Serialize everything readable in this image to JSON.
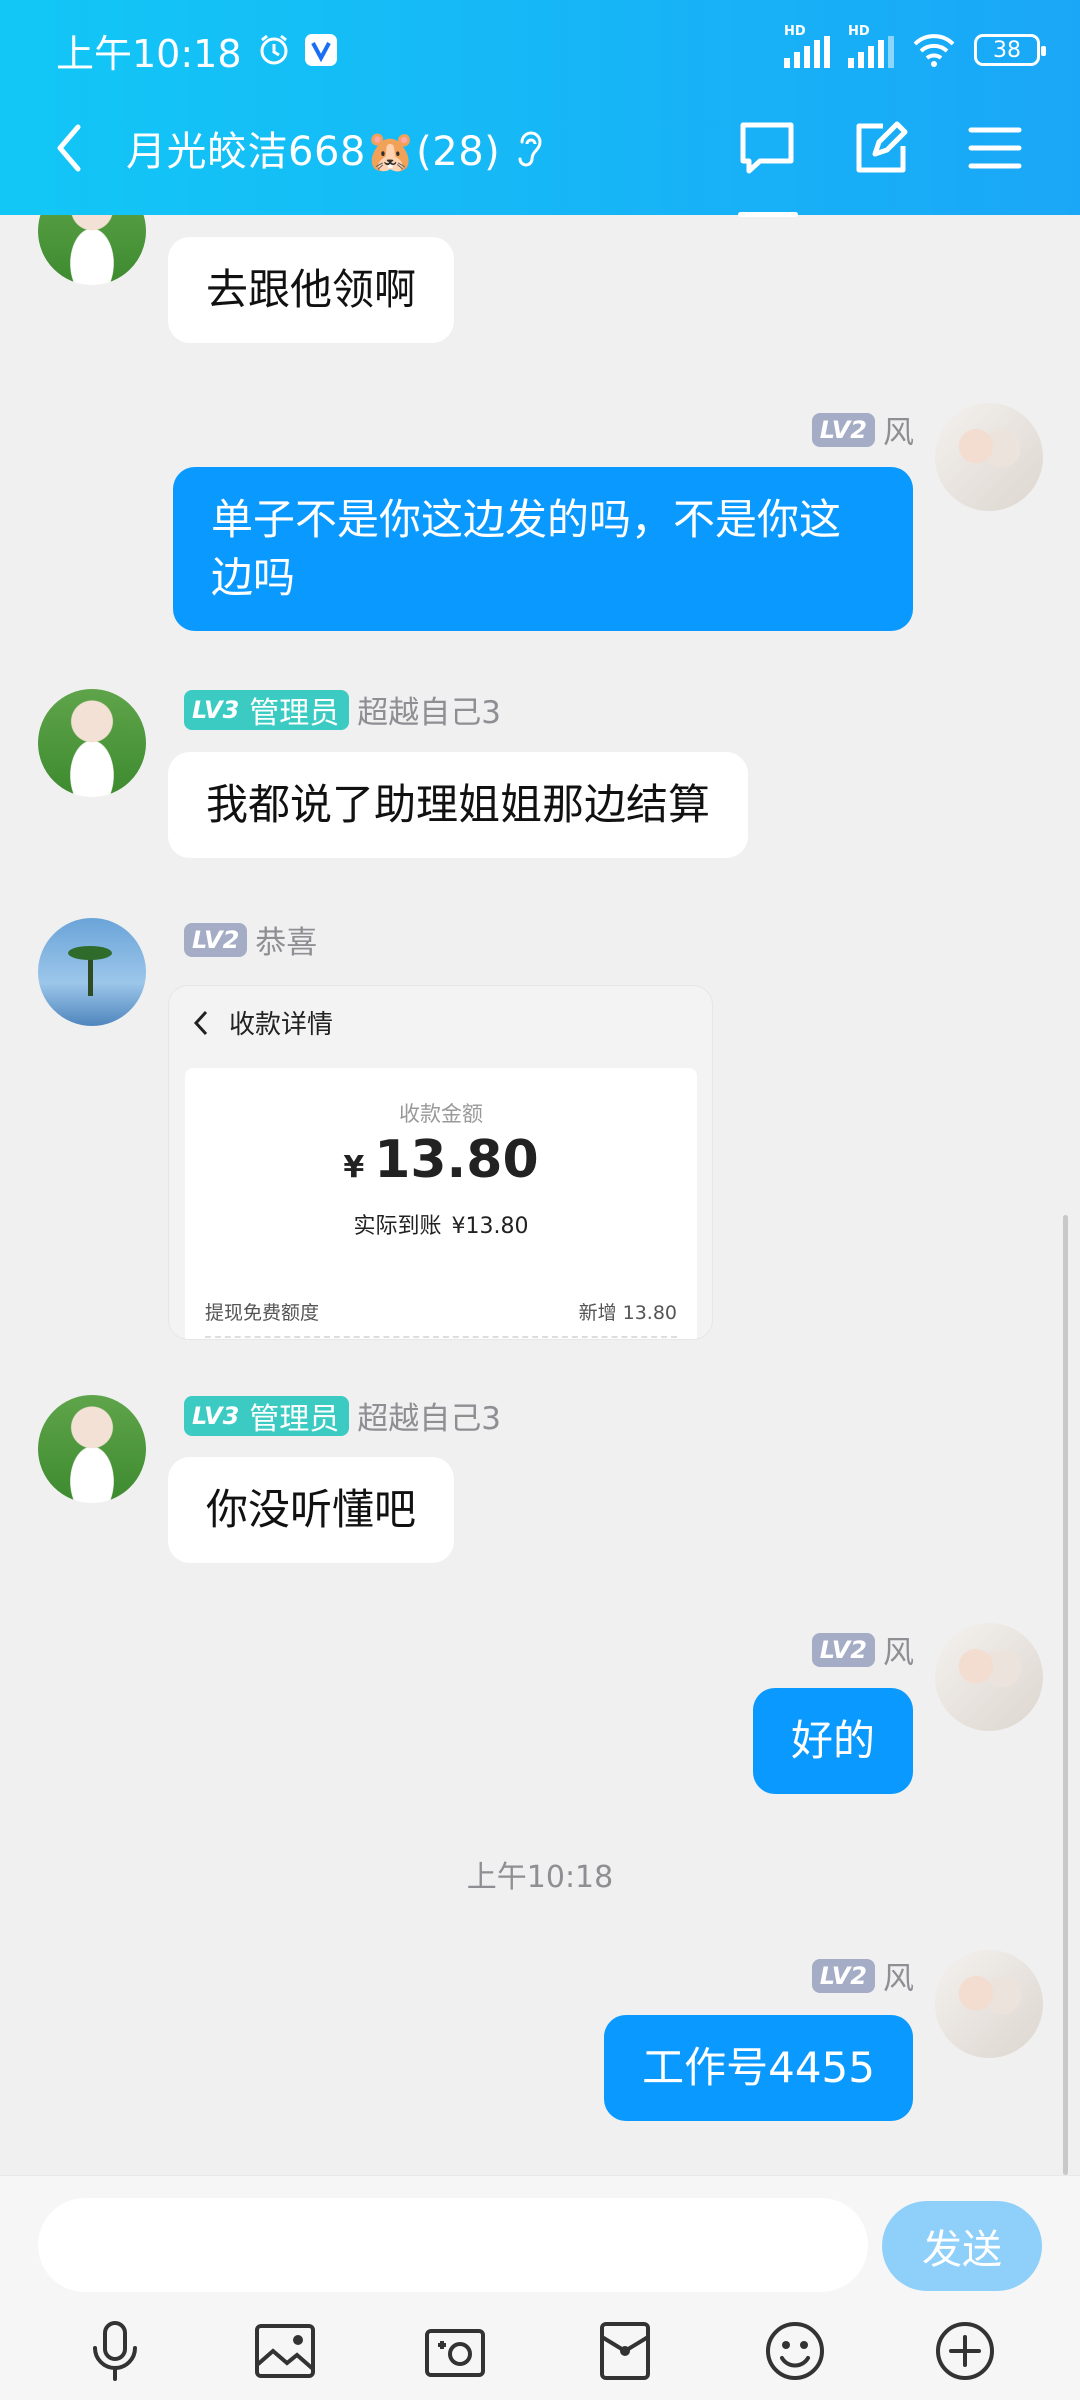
{
  "status_bar": {
    "time": "上午10:18",
    "battery": "38",
    "hd1": "HD",
    "hd2": "HD"
  },
  "header": {
    "title": "月光皎洁668🐹(28)"
  },
  "messages": [
    {
      "text": "去跟他领啊"
    },
    {
      "level": "LV2",
      "sender": "风",
      "text": "单子不是你这边发的吗，不是你这边吗"
    },
    {
      "level": "LV3",
      "role": "管理员",
      "sender": "超越自己3",
      "text": "我都说了助理姐姐那边结算"
    },
    {
      "level": "LV2",
      "sender": "恭喜"
    },
    {
      "level": "LV3",
      "role": "管理员",
      "sender": "超越自己3",
      "text": "你没听懂吧"
    },
    {
      "level": "LV2",
      "sender": "风",
      "text": "好的"
    },
    {
      "level": "LV2",
      "sender": "风",
      "text": "工作号4455"
    }
  ],
  "receipt": {
    "title": "收款详情",
    "amount_label": "收款金额",
    "currency": "¥",
    "amount": "13.80",
    "actual_label": "实际到账",
    "actual_value": "¥13.80",
    "quota_label": "提现免费额度",
    "quota_value": "新增 13.80"
  },
  "timestamp": "上午10:18",
  "composer": {
    "send_label": "发送",
    "placeholder": ""
  }
}
